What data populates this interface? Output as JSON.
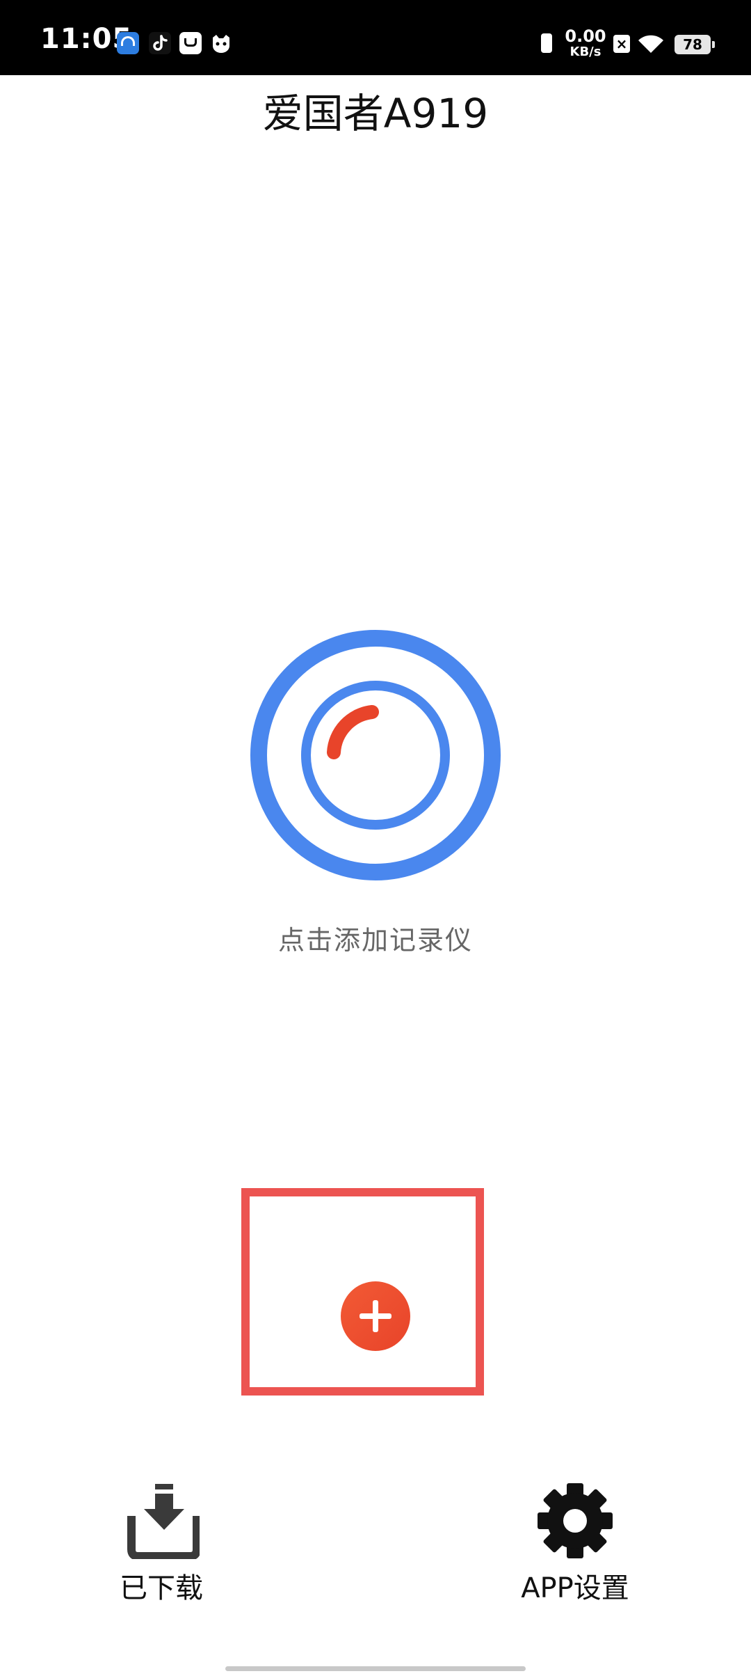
{
  "status_bar": {
    "time": "11:05",
    "net_speed_value": "0.00",
    "net_speed_unit": "KB/s",
    "battery": "78",
    "icons": [
      "baidu-netdisk-icon",
      "tiktok-icon",
      "mail-icon",
      "cat-app-icon",
      "vibrate-icon",
      "no-sim-icon",
      "wifi-icon",
      "battery-icon"
    ]
  },
  "header": {
    "title": "爱国者A919"
  },
  "main": {
    "empty_hint": "点击添加记录仪",
    "graphic_icon": "dashcam-lens-icon",
    "add_button_icon": "plus-icon"
  },
  "bottom_nav": {
    "downloaded_label": "已下载",
    "downloaded_icon": "download-tray-icon",
    "settings_label": "APP设置",
    "settings_icon": "gear-icon"
  },
  "colors": {
    "accent_blue": "#4a87ee",
    "accent_red": "#e8442a",
    "highlight_border": "#ec5451",
    "nav_icon": "#3a3a3a"
  }
}
